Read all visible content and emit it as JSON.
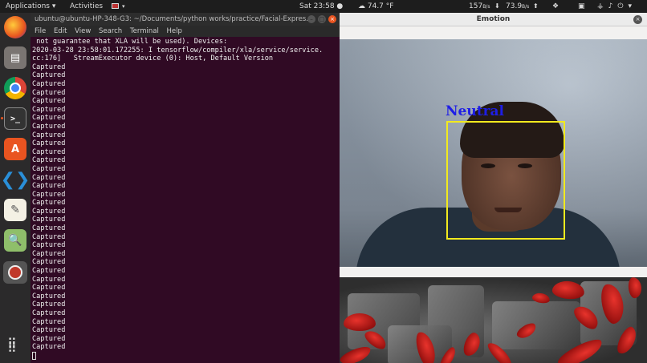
{
  "topbar": {
    "applications": "Applications ▾",
    "activities": "Activities",
    "dropdown": "▾",
    "clock": "Sat 23:58 ●",
    "temperature": "☁ 74.7 °F",
    "net_down": "157",
    "net_down_unit": "B/s",
    "net_load": "73.9",
    "net_load_unit": "B/s"
  },
  "dock": {
    "items": [
      "firefox",
      "files",
      "chrome",
      "terminal",
      "software-center",
      "vscode",
      "text-editor",
      "image-viewer",
      "screen-recorder"
    ]
  },
  "terminal": {
    "title": "ubuntu@ubuntu-HP-348-G3: ~/Documents/python works/practice/Facial-Expres...",
    "menu": [
      "File",
      "Edit",
      "View",
      "Search",
      "Terminal",
      "Help"
    ],
    "lines": [
      " not guarantee that XLA will be used). Devices:",
      "2020-03-28 23:58:01.172255: I tensorflow/compiler/xla/service/service.",
      "cc:176]   StreamExecutor device (0): Host, Default Version",
      "Captured",
      "Captured",
      "Captured",
      "Captured",
      "Captured",
      "Captured",
      "Captured",
      "Captured",
      "Captured",
      "Captured",
      "Captured",
      "Captured",
      "Captured",
      "Captured",
      "Captured",
      "Captured",
      "Captured",
      "Captured",
      "Captured",
      "Captured",
      "Captured",
      "Captured",
      "Captured",
      "Captured",
      "Captured",
      "Captured",
      "Captured",
      "Captured",
      "Captured",
      "Captured",
      "Captured",
      "Captured",
      "Captured",
      "Captured"
    ]
  },
  "emotion_window": {
    "title": "Emotion",
    "detected_emotion": "Neutral",
    "box_color": "#f2ea1e",
    "label_color": "#1e1ee6"
  },
  "colors": {
    "terminal_bg": "#300a24",
    "accent": "#e95420"
  }
}
